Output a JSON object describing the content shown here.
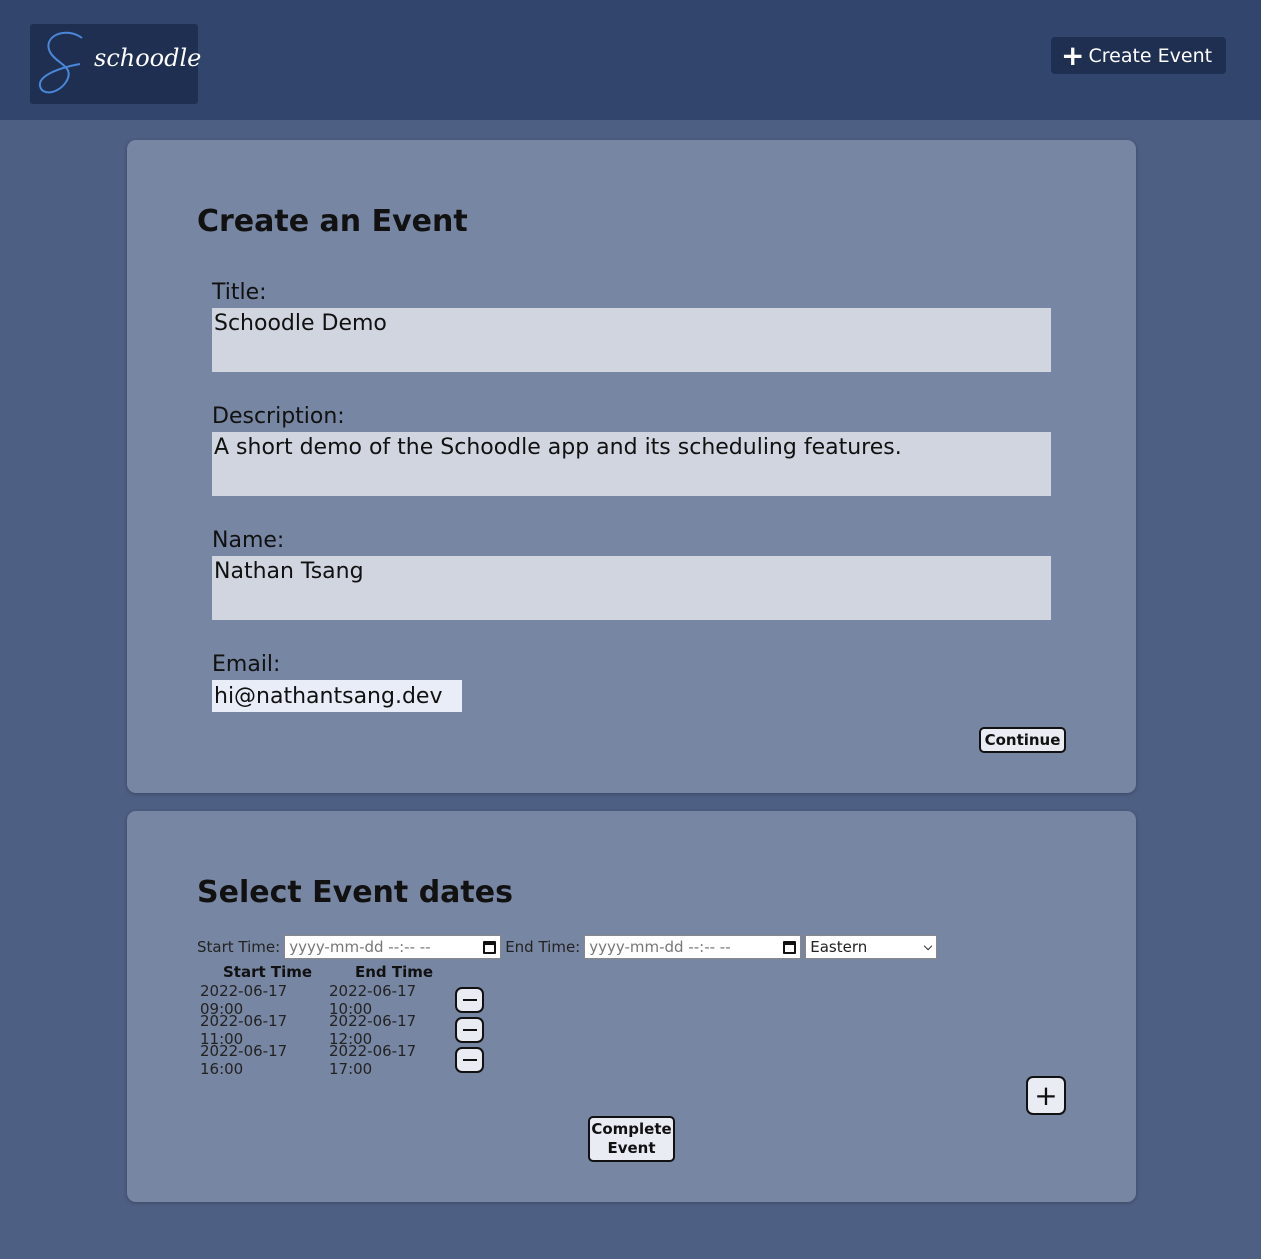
{
  "header": {
    "logo_text": "schoodle",
    "create_event_label": "Create Event"
  },
  "create_card": {
    "title": "Create an Event",
    "fields": {
      "title_label": "Title:",
      "title_value": "Schoodle Demo",
      "description_label": "Description:",
      "description_value": "A short demo of the Schoodle app and its scheduling features.",
      "name_label": "Name:",
      "name_value": "Nathan Tsang",
      "email_label": "Email:",
      "email_value": "hi@nathantsang.dev"
    },
    "continue_label": "Continue"
  },
  "dates_card": {
    "title": "Select Event dates",
    "start_time_label": "Start Time:",
    "end_time_label": "End Time:",
    "start_placeholder": "yyyy-mm-dd --:-- --",
    "end_placeholder": "yyyy-mm-dd --:-- --",
    "timezone_selected": "Eastern",
    "table_headers": {
      "start": "Start Time",
      "end": "End Time"
    },
    "slots": [
      {
        "start": "2022-06-17 09:00",
        "end": "2022-06-17 10:00"
      },
      {
        "start": "2022-06-17 11:00",
        "end": "2022-06-17 12:00"
      },
      {
        "start": "2022-06-17 16:00",
        "end": "2022-06-17 17:00"
      }
    ],
    "add_slot_label": "+",
    "complete_label": "Complete Event"
  },
  "colors": {
    "page_bg": "#4e5f84",
    "topbar_bg": "#32466d",
    "card_bg": "#7786a2",
    "field_bg": "#d0d5e0",
    "logo_bg": "#1f2f52",
    "logo_accent": "#4a86d8"
  }
}
